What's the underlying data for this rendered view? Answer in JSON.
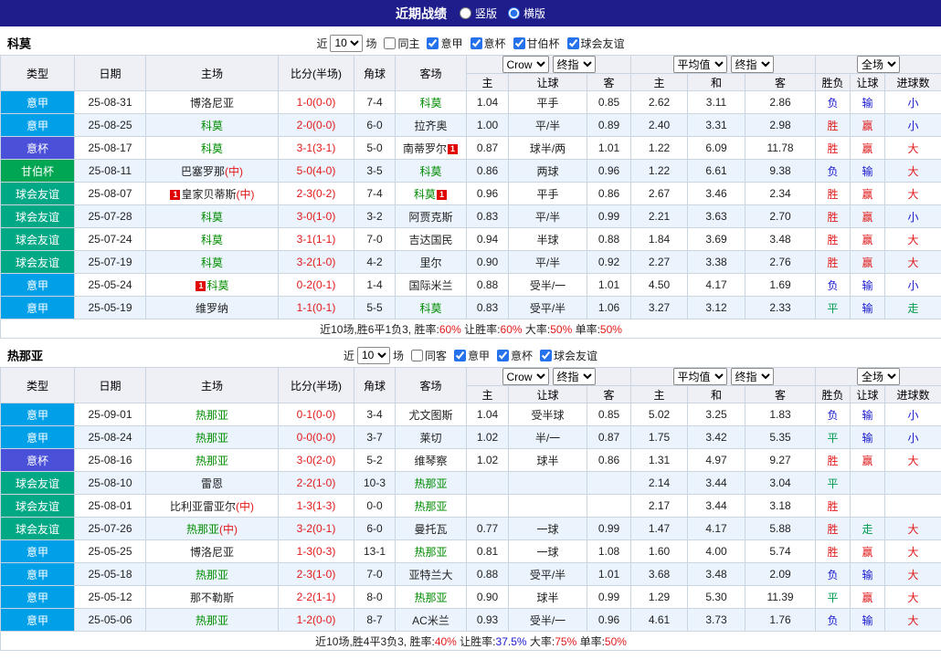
{
  "palette": {
    "red": "#E21919",
    "blue": "#1717CE",
    "green": "#00994D",
    "team": "#008C00"
  },
  "type_colors": {
    "意甲": "#00A0E9",
    "意杯": "#4A50D8",
    "甘伯杯": "#00A651",
    "球会友谊": "#00A885"
  },
  "topbar": {
    "title": "近期战绩",
    "radios": [
      {
        "label": "竖版",
        "checked": false
      },
      {
        "label": "横版",
        "checked": true
      }
    ]
  },
  "table_header": {
    "type": "类型",
    "date": "日期",
    "home": "主场",
    "score": "比分(半场)",
    "corner": "角球",
    "away": "客场",
    "odds_selects": [
      "Crow",
      "终指"
    ],
    "avg_selects": [
      "平均值",
      "终指"
    ],
    "full_select": "全场",
    "odds_sub": [
      "主",
      "让球",
      "客"
    ],
    "avg_sub": [
      "主",
      "和",
      "客"
    ],
    "full_sub": [
      "胜负",
      "让球",
      "进球数"
    ]
  },
  "sections": [
    {
      "team": "科莫",
      "filter": {
        "near": "近",
        "count": "10",
        "games": "场",
        "same": {
          "label": "同主",
          "checked": false
        },
        "leagues": [
          {
            "label": "意甲",
            "checked": true
          },
          {
            "label": "意杯",
            "checked": true
          },
          {
            "label": "甘伯杯",
            "checked": true
          },
          {
            "label": "球会友谊",
            "checked": true
          }
        ]
      },
      "rows": [
        {
          "type": "意甲",
          "date": "25-08-31",
          "home": [
            {
              "t": "博洛尼亚"
            }
          ],
          "score": "1-0(0-0)",
          "corner": "7-4",
          "away": [
            {
              "t": "科莫",
              "c": "team"
            }
          ],
          "o1": [
            "1.04",
            "平手",
            "0.85"
          ],
          "o2": [
            "2.62",
            "3.11",
            "2.86"
          ],
          "res": [
            {
              "t": "负",
              "c": "blue"
            },
            {
              "t": "输",
              "c": "blue"
            },
            {
              "t": "小",
              "c": "blue"
            }
          ]
        },
        {
          "type": "意甲",
          "date": "25-08-25",
          "home": [
            {
              "t": "科莫",
              "c": "team"
            }
          ],
          "score": "2-0(0-0)",
          "corner": "6-0",
          "away": [
            {
              "t": "拉齐奥"
            }
          ],
          "o1": [
            "1.00",
            "平/半",
            "0.89"
          ],
          "o2": [
            "2.40",
            "3.31",
            "2.98"
          ],
          "res": [
            {
              "t": "胜",
              "c": "red"
            },
            {
              "t": "赢",
              "c": "red"
            },
            {
              "t": "小",
              "c": "blue"
            }
          ]
        },
        {
          "type": "意杯",
          "date": "25-08-17",
          "home": [
            {
              "t": "科莫",
              "c": "team"
            }
          ],
          "score": "3-1(3-1)",
          "corner": "5-0",
          "away": [
            {
              "t": "南蒂罗尔"
            },
            {
              "t": "1",
              "card": true
            }
          ],
          "o1": [
            "0.87",
            "球半/两",
            "1.01"
          ],
          "o2": [
            "1.22",
            "6.09",
            "11.78"
          ],
          "res": [
            {
              "t": "胜",
              "c": "red"
            },
            {
              "t": "赢",
              "c": "red"
            },
            {
              "t": "大",
              "c": "red"
            }
          ]
        },
        {
          "type": "甘伯杯",
          "date": "25-08-11",
          "home": [
            {
              "t": "巴塞罗那"
            },
            {
              "t": "(中)",
              "c": "red"
            }
          ],
          "score": "5-0(4-0)",
          "corner": "3-5",
          "away": [
            {
              "t": "科莫",
              "c": "team"
            }
          ],
          "o1": [
            "0.86",
            "两球",
            "0.96"
          ],
          "o2": [
            "1.22",
            "6.61",
            "9.38"
          ],
          "res": [
            {
              "t": "负",
              "c": "blue"
            },
            {
              "t": "输",
              "c": "blue"
            },
            {
              "t": "大",
              "c": "red"
            }
          ]
        },
        {
          "type": "球会友谊",
          "date": "25-08-07",
          "home": [
            {
              "t": "1",
              "card": true
            },
            {
              "t": "皇家贝蒂斯"
            },
            {
              "t": "(中)",
              "c": "red"
            }
          ],
          "score": "2-3(0-2)",
          "corner": "7-4",
          "away": [
            {
              "t": "科莫",
              "c": "team"
            },
            {
              "t": "1",
              "card": true
            }
          ],
          "o1": [
            "0.96",
            "平手",
            "0.86"
          ],
          "o2": [
            "2.67",
            "3.46",
            "2.34"
          ],
          "res": [
            {
              "t": "胜",
              "c": "red"
            },
            {
              "t": "赢",
              "c": "red"
            },
            {
              "t": "大",
              "c": "red"
            }
          ]
        },
        {
          "type": "球会友谊",
          "date": "25-07-28",
          "home": [
            {
              "t": "科莫",
              "c": "team"
            }
          ],
          "score": "3-0(1-0)",
          "corner": "3-2",
          "away": [
            {
              "t": "阿贾克斯"
            }
          ],
          "o1": [
            "0.83",
            "平/半",
            "0.99"
          ],
          "o2": [
            "2.21",
            "3.63",
            "2.70"
          ],
          "res": [
            {
              "t": "胜",
              "c": "red"
            },
            {
              "t": "赢",
              "c": "red"
            },
            {
              "t": "小",
              "c": "blue"
            }
          ]
        },
        {
          "type": "球会友谊",
          "date": "25-07-24",
          "home": [
            {
              "t": "科莫",
              "c": "team"
            }
          ],
          "score": "3-1(1-1)",
          "corner": "7-0",
          "away": [
            {
              "t": "吉达国民"
            }
          ],
          "o1": [
            "0.94",
            "半球",
            "0.88"
          ],
          "o2": [
            "1.84",
            "3.69",
            "3.48"
          ],
          "res": [
            {
              "t": "胜",
              "c": "red"
            },
            {
              "t": "赢",
              "c": "red"
            },
            {
              "t": "大",
              "c": "red"
            }
          ]
        },
        {
          "type": "球会友谊",
          "date": "25-07-19",
          "home": [
            {
              "t": "科莫",
              "c": "team"
            }
          ],
          "score": "3-2(1-0)",
          "corner": "4-2",
          "away": [
            {
              "t": "里尔"
            }
          ],
          "o1": [
            "0.90",
            "平/半",
            "0.92"
          ],
          "o2": [
            "2.27",
            "3.38",
            "2.76"
          ],
          "res": [
            {
              "t": "胜",
              "c": "red"
            },
            {
              "t": "赢",
              "c": "red"
            },
            {
              "t": "大",
              "c": "red"
            }
          ]
        },
        {
          "type": "意甲",
          "date": "25-05-24",
          "home": [
            {
              "t": "1",
              "card": true
            },
            {
              "t": "科莫",
              "c": "team"
            }
          ],
          "score": "0-2(0-1)",
          "corner": "1-4",
          "away": [
            {
              "t": "国际米兰"
            }
          ],
          "o1": [
            "0.88",
            "受半/一",
            "1.01"
          ],
          "o2": [
            "4.50",
            "4.17",
            "1.69"
          ],
          "res": [
            {
              "t": "负",
              "c": "blue"
            },
            {
              "t": "输",
              "c": "blue"
            },
            {
              "t": "小",
              "c": "blue"
            }
          ]
        },
        {
          "type": "意甲",
          "date": "25-05-19",
          "home": [
            {
              "t": "维罗纳"
            }
          ],
          "score": "1-1(0-1)",
          "corner": "5-5",
          "away": [
            {
              "t": "科莫",
              "c": "team"
            }
          ],
          "o1": [
            "0.83",
            "受平/半",
            "1.06"
          ],
          "o2": [
            "3.27",
            "3.12",
            "2.33"
          ],
          "res": [
            {
              "t": "平",
              "c": "green"
            },
            {
              "t": "输",
              "c": "blue"
            },
            {
              "t": "走",
              "c": "green"
            }
          ]
        }
      ],
      "summary": [
        {
          "t": "近10场,胜6平1负3, 胜率:"
        },
        {
          "t": "60%",
          "c": "red"
        },
        {
          "t": " 让胜率:"
        },
        {
          "t": "60%",
          "c": "red"
        },
        {
          "t": " 大率:"
        },
        {
          "t": "50%",
          "c": "red"
        },
        {
          "t": " 单率:"
        },
        {
          "t": "50%",
          "c": "red"
        }
      ]
    },
    {
      "team": "热那亚",
      "filter": {
        "near": "近",
        "count": "10",
        "games": "场",
        "same": {
          "label": "同客",
          "checked": false
        },
        "leagues": [
          {
            "label": "意甲",
            "checked": true
          },
          {
            "label": "意杯",
            "checked": true
          },
          {
            "label": "球会友谊",
            "checked": true
          }
        ]
      },
      "rows": [
        {
          "type": "意甲",
          "date": "25-09-01",
          "home": [
            {
              "t": "热那亚",
              "c": "team"
            }
          ],
          "score": "0-1(0-0)",
          "corner": "3-4",
          "away": [
            {
              "t": "尤文图斯"
            }
          ],
          "o1": [
            "1.04",
            "受半球",
            "0.85"
          ],
          "o2": [
            "5.02",
            "3.25",
            "1.83"
          ],
          "res": [
            {
              "t": "负",
              "c": "blue"
            },
            {
              "t": "输",
              "c": "blue"
            },
            {
              "t": "小",
              "c": "blue"
            }
          ]
        },
        {
          "type": "意甲",
          "date": "25-08-24",
          "home": [
            {
              "t": "热那亚",
              "c": "team"
            }
          ],
          "score": "0-0(0-0)",
          "corner": "3-7",
          "away": [
            {
              "t": "莱切"
            }
          ],
          "o1": [
            "1.02",
            "半/一",
            "0.87"
          ],
          "o2": [
            "1.75",
            "3.42",
            "5.35"
          ],
          "res": [
            {
              "t": "平",
              "c": "green"
            },
            {
              "t": "输",
              "c": "blue"
            },
            {
              "t": "小",
              "c": "blue"
            }
          ]
        },
        {
          "type": "意杯",
          "date": "25-08-16",
          "home": [
            {
              "t": "热那亚",
              "c": "team"
            }
          ],
          "score": "3-0(2-0)",
          "corner": "5-2",
          "away": [
            {
              "t": "维琴察"
            }
          ],
          "o1": [
            "1.02",
            "球半",
            "0.86"
          ],
          "o2": [
            "1.31",
            "4.97",
            "9.27"
          ],
          "res": [
            {
              "t": "胜",
              "c": "red"
            },
            {
              "t": "赢",
              "c": "red"
            },
            {
              "t": "大",
              "c": "red"
            }
          ]
        },
        {
          "type": "球会友谊",
          "date": "25-08-10",
          "home": [
            {
              "t": "雷恩"
            }
          ],
          "score": "2-2(1-0)",
          "corner": "10-3",
          "away": [
            {
              "t": "热那亚",
              "c": "team"
            }
          ],
          "o1": [
            "",
            "",
            ""
          ],
          "o2": [
            "2.14",
            "3.44",
            "3.04"
          ],
          "res": [
            {
              "t": "平",
              "c": "green"
            },
            {
              "t": ""
            },
            {
              "t": ""
            }
          ]
        },
        {
          "type": "球会友谊",
          "date": "25-08-01",
          "home": [
            {
              "t": "比利亚雷亚尔"
            },
            {
              "t": "(中)",
              "c": "red"
            }
          ],
          "score": "1-3(1-3)",
          "corner": "0-0",
          "away": [
            {
              "t": "热那亚",
              "c": "team"
            }
          ],
          "o1": [
            "",
            "",
            ""
          ],
          "o2": [
            "2.17",
            "3.44",
            "3.18"
          ],
          "res": [
            {
              "t": "胜",
              "c": "red"
            },
            {
              "t": ""
            },
            {
              "t": ""
            }
          ]
        },
        {
          "type": "球会友谊",
          "date": "25-07-26",
          "home": [
            {
              "t": "热那亚",
              "c": "team"
            },
            {
              "t": "(中)",
              "c": "red"
            }
          ],
          "score": "3-2(0-1)",
          "corner": "6-0",
          "away": [
            {
              "t": "曼托瓦"
            }
          ],
          "o1": [
            "0.77",
            "一球",
            "0.99"
          ],
          "o2": [
            "1.47",
            "4.17",
            "5.88"
          ],
          "res": [
            {
              "t": "胜",
              "c": "red"
            },
            {
              "t": "走",
              "c": "green"
            },
            {
              "t": "大",
              "c": "red"
            }
          ]
        },
        {
          "type": "意甲",
          "date": "25-05-25",
          "home": [
            {
              "t": "博洛尼亚"
            }
          ],
          "score": "1-3(0-3)",
          "corner": "13-1",
          "away": [
            {
              "t": "热那亚",
              "c": "team"
            }
          ],
          "o1": [
            "0.81",
            "一球",
            "1.08"
          ],
          "o2": [
            "1.60",
            "4.00",
            "5.74"
          ],
          "res": [
            {
              "t": "胜",
              "c": "red"
            },
            {
              "t": "赢",
              "c": "red"
            },
            {
              "t": "大",
              "c": "red"
            }
          ]
        },
        {
          "type": "意甲",
          "date": "25-05-18",
          "home": [
            {
              "t": "热那亚",
              "c": "team"
            }
          ],
          "score": "2-3(1-0)",
          "corner": "7-0",
          "away": [
            {
              "t": "亚特兰大"
            }
          ],
          "o1": [
            "0.88",
            "受平/半",
            "1.01"
          ],
          "o2": [
            "3.68",
            "3.48",
            "2.09"
          ],
          "res": [
            {
              "t": "负",
              "c": "blue"
            },
            {
              "t": "输",
              "c": "blue"
            },
            {
              "t": "大",
              "c": "red"
            }
          ]
        },
        {
          "type": "意甲",
          "date": "25-05-12",
          "home": [
            {
              "t": "那不勒斯"
            }
          ],
          "score": "2-2(1-1)",
          "corner": "8-0",
          "away": [
            {
              "t": "热那亚",
              "c": "team"
            }
          ],
          "o1": [
            "0.90",
            "球半",
            "0.99"
          ],
          "o2": [
            "1.29",
            "5.30",
            "11.39"
          ],
          "res": [
            {
              "t": "平",
              "c": "green"
            },
            {
              "t": "赢",
              "c": "red"
            },
            {
              "t": "大",
              "c": "red"
            }
          ]
        },
        {
          "type": "意甲",
          "date": "25-05-06",
          "home": [
            {
              "t": "热那亚",
              "c": "team"
            }
          ],
          "score": "1-2(0-0)",
          "corner": "8-7",
          "away": [
            {
              "t": "AC米兰"
            }
          ],
          "o1": [
            "0.93",
            "受半/一",
            "0.96"
          ],
          "o2": [
            "4.61",
            "3.73",
            "1.76"
          ],
          "res": [
            {
              "t": "负",
              "c": "blue"
            },
            {
              "t": "输",
              "c": "blue"
            },
            {
              "t": "大",
              "c": "red"
            }
          ]
        }
      ],
      "summary": [
        {
          "t": "近10场,胜4平3负3, 胜率:"
        },
        {
          "t": "40%",
          "c": "red"
        },
        {
          "t": " 让胜率:"
        },
        {
          "t": "37.5%",
          "c": "blue"
        },
        {
          "t": " 大率:"
        },
        {
          "t": "75%",
          "c": "red"
        },
        {
          "t": " 单率:"
        },
        {
          "t": "50%",
          "c": "red"
        }
      ]
    }
  ]
}
